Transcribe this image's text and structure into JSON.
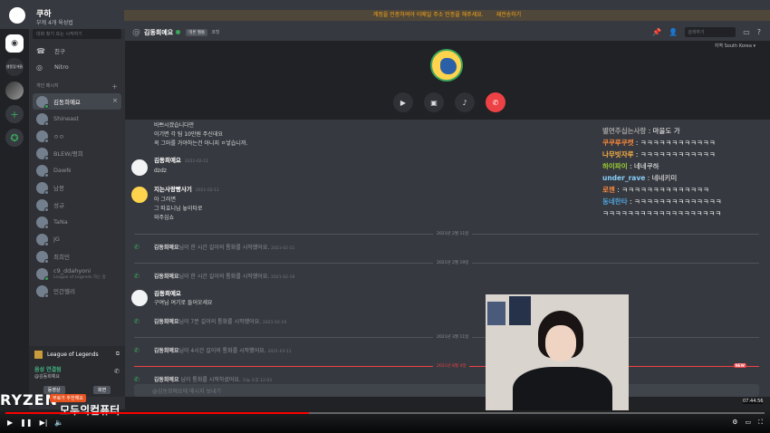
{
  "top": {
    "streamer": "쿠하",
    "streamer_sub": "부캐 4개 육성법",
    "banner_left": "계정을 인증하여야 이메일 주소 인증을 해주세요.",
    "banner_right": "재전송하기"
  },
  "rail": {
    "server_label": "쌩뚱맞게들"
  },
  "sidebar": {
    "search_placeholder": "대화 찾기 또는 시작하기",
    "nav": [
      {
        "label": "친구"
      },
      {
        "label": "Nitro"
      }
    ],
    "dm_header": "개인 메시지",
    "dm_add": "+",
    "dms": [
      {
        "name": "김동희예요",
        "active": true,
        "online": true
      },
      {
        "name": "Shineast",
        "online": false
      },
      {
        "name": "ㅇㅇ",
        "online": false
      },
      {
        "name": "BLEW/평희",
        "online": false
      },
      {
        "name": "DawN",
        "online": false
      },
      {
        "name": "남봉",
        "online": false
      },
      {
        "name": "성규",
        "online": false
      },
      {
        "name": "TaNa",
        "online": false
      },
      {
        "name": "JG",
        "online": false
      },
      {
        "name": "최희민",
        "online": false
      },
      {
        "name": "c9_ddahyoni",
        "sub": "League of Legends 하는 중",
        "online": true
      },
      {
        "name": "민간헬리",
        "online": false
      }
    ],
    "game": "League of Legends",
    "voice_status": "음성 연결됨",
    "voice_sub": "@김동희예요",
    "video_label": "동영상",
    "screen_label": "화면"
  },
  "header": {
    "channel": "김동희예요",
    "tag1": "테론 웹통",
    "tag2": "코칫",
    "search_placeholder": "검색하기",
    "region_label": "지역",
    "region_value": "South Korea"
  },
  "chat": {
    "messages": [
      {
        "text": "바쁘시겠습니다만"
      },
      {
        "text": "이기면 각 팀 10만원 주신데요"
      },
      {
        "text": "꼭 그마를 가야하는건 아니지 ㅇ낳습니까."
      },
      {
        "author": "김동희예요",
        "time": "2021-02-11",
        "text": "dzdz"
      },
      {
        "author": "지는사랑빵사기",
        "time": "2021-02-11",
        "lines": [
          "아 그러면",
          "그 따효니님 놓이타로",
          "와주십쇼"
        ]
      }
    ],
    "date1": "2021년 2월 11일",
    "call1": {
      "name": "김동희예요",
      "text": "님이 한 시간 길이의 통화를 시작했어요.",
      "time": "2021-02-11"
    },
    "date2": "2021년 2월 19일",
    "call2": {
      "name": "김동희예요",
      "text": "님이 한 시간 길이의 통화를 시작했어요.",
      "time": "2021-02-19"
    },
    "msg3": {
      "author": "김동희예요",
      "text": "구여님 여기로 들어오세요"
    },
    "call3": {
      "name": "김동희예요",
      "text": "님이 7분 길이의 통화를 시작했어요.",
      "time": "2021-02-19"
    },
    "date3": "2021년 3월 11일",
    "call4": {
      "name": "김동희예요",
      "text": "님이 4시간 길이의 통화를 시작했어요.",
      "time": "2021-03-11"
    },
    "date4": "2021년 8월 4일",
    "new_label": "NEW",
    "call5": {
      "name": "김동희예요",
      "text": " 님이 통화를 시작하셨어요.",
      "time": "오늘 오후 12:03"
    },
    "composer_placeholder": "@김동희예요에 메시지 보내기"
  },
  "overlay_chat": [
    {
      "name": "별연주십는사랑",
      "text": ": 마을도 가",
      "color": "#a0a0a0"
    },
    {
      "name": "쿠쿠루쿠캣",
      "text": ": ㅋㅋㅋㅋㅋㅋㅋㅋㅋㅋㅋㅋ",
      "color": "#ff8a3d"
    },
    {
      "name": "나무빗자루",
      "text": ": ㅋㅋㅋㅋㅋㅋㅋㅋㅋㅋㅋㅋ",
      "color": "#ffb347"
    },
    {
      "name": "하이파이",
      "text": ": 네네쿠하",
      "color": "#9acd32"
    },
    {
      "name": "under_rave",
      "text": ": 네네키미",
      "color": "#87cefa"
    },
    {
      "name": "로젠",
      "text": ": ㅋㅋㅋㅋㅋㅋㅋㅋㅋㅋㅋㅋㅋㅋ",
      "color": "#ff8a3d"
    },
    {
      "name": "동네한타",
      "text": ": ㅋㅋㅋㅋㅋㅋㅋㅋㅋㅋㅋㅋㅋㅋ",
      "color": "#4fa0d8"
    },
    {
      "name": "",
      "text": "ㅋㅋㅋㅋㅋㅋㅋㅋㅋㅋㅋㅋㅋㅋㅋㅋㅋㅋㅋ",
      "color": "#ffffff"
    }
  ],
  "promo": {
    "brand": "RYZEN",
    "tag": "무료가 추천해요",
    "title": "모두의컴퓨터"
  },
  "player": {
    "time": "07:44:56",
    "progress": 0.4
  },
  "colors": {
    "accent": "#5865f2",
    "online": "#3ba55c",
    "danger": "#ed4245"
  }
}
